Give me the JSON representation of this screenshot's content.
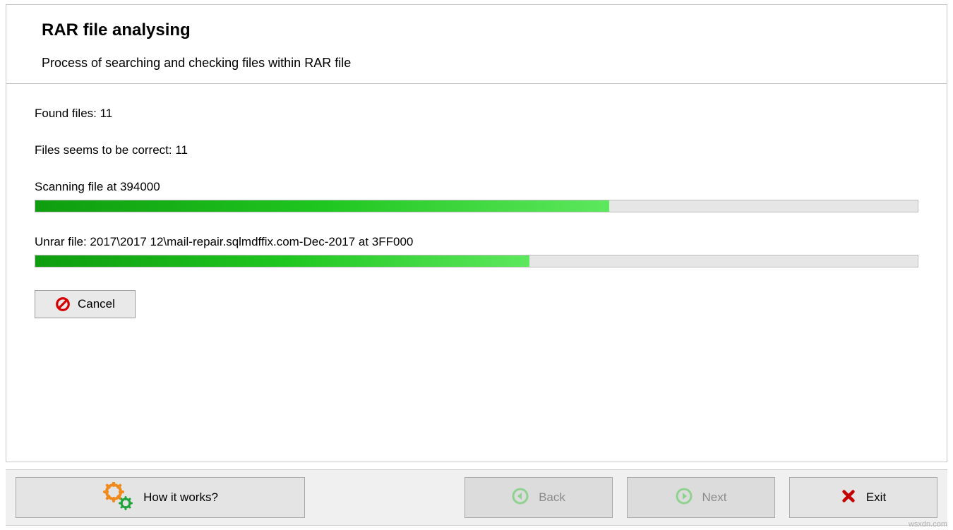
{
  "header": {
    "title": "RAR file analysing",
    "subtitle": "Process of searching and checking files within RAR file"
  },
  "status": {
    "found_label": "Found files: 11",
    "correct_label": "Files seems to be correct: 11"
  },
  "progress1": {
    "label": "Scanning file at 394000",
    "percent": 65
  },
  "progress2": {
    "label": "Unrar file: 2017\\2017 12\\mail-repair.sqlmdffix.com-Dec-2017 at 3FF000",
    "percent": 56
  },
  "buttons": {
    "cancel": "Cancel",
    "how": "How it works?",
    "back": "Back",
    "next": "Next",
    "exit": "Exit"
  },
  "watermark": "wsxdn.com"
}
